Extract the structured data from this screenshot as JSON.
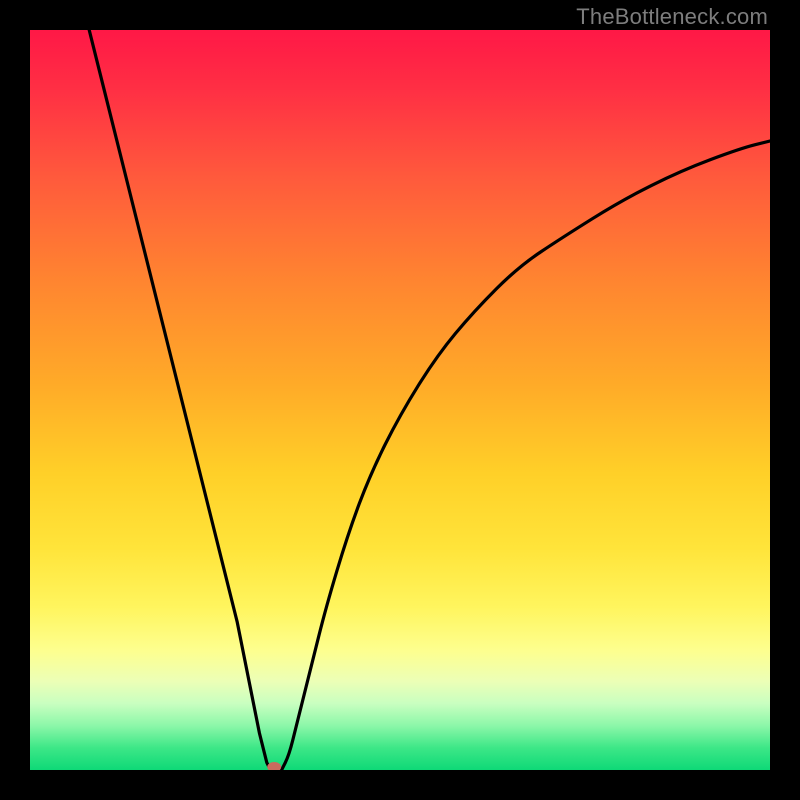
{
  "watermark": "TheBottleneck.com",
  "colors": {
    "frame": "#000000",
    "curve": "#000000",
    "marker": "#c96b5e",
    "gradient_stops": [
      "#ff1846",
      "#ff2f44",
      "#ff5a3c",
      "#ff8530",
      "#ffab28",
      "#ffd028",
      "#ffe43a",
      "#fff55e",
      "#fdff90",
      "#ecffb6",
      "#c9ffc0",
      "#8cf7a9",
      "#3de787",
      "#0ed977"
    ]
  },
  "chart_data": {
    "type": "line",
    "title": "",
    "xlabel": "",
    "ylabel": "",
    "xlim": [
      0,
      100
    ],
    "ylim": [
      0,
      100
    ],
    "grid": false,
    "legend": false,
    "series": [
      {
        "name": "curve-left",
        "x": [
          8,
          10,
          12,
          14,
          16,
          18,
          20,
          22,
          24,
          26,
          28,
          30,
          31,
          32,
          32.5
        ],
        "y": [
          100,
          92,
          84,
          76,
          68,
          60,
          52,
          44,
          36,
          28,
          20,
          10,
          5,
          1,
          0
        ]
      },
      {
        "name": "curve-right",
        "x": [
          34,
          35,
          36,
          38,
          40,
          43,
          46,
          50,
          55,
          60,
          66,
          72,
          80,
          88,
          96,
          100
        ],
        "y": [
          0,
          2,
          6,
          14,
          22,
          32,
          40,
          48,
          56,
          62,
          68,
          72,
          77,
          81,
          84,
          85
        ]
      }
    ],
    "marker": {
      "x": 33,
      "y": 0,
      "color": "#c96b5e"
    },
    "notes": "Axis values are in percent of the visible plot area (0 = left/bottom edge of gradient, 100 = right/top edge). The two series together form a single V-shaped bottleneck curve with its minimum at roughly x≈33. Values are estimated from pixel positions; the image has no numeric tick labels."
  }
}
